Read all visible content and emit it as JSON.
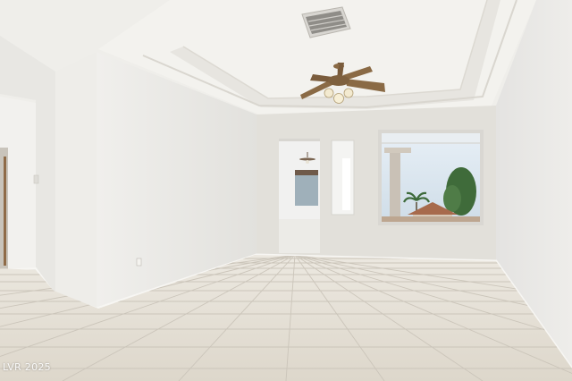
{
  "watermark": {
    "text": "LVR 2025"
  },
  "colors": {
    "wall_back": "#e3e1dc",
    "wall_side": "#ecebe8",
    "ceiling": "#f1f0ec",
    "floor_tile": "#e6e1d7",
    "grout": "#cbc5ba",
    "sky": "#dfe9f1",
    "fan_bronze": "#8a6a45"
  },
  "icons": [
    "ceiling-fan-icon",
    "air-vent-icon",
    "outlet-icon"
  ]
}
